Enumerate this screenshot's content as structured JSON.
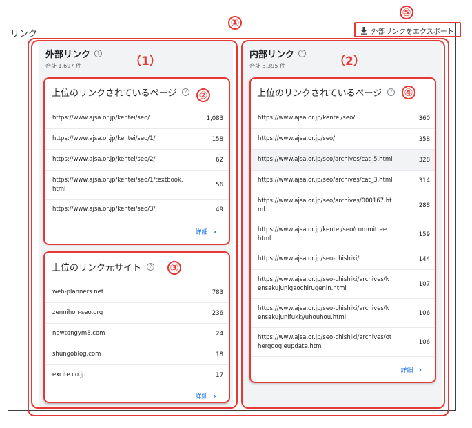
{
  "page": {
    "title": "リンク"
  },
  "export": {
    "label": "外部リンクをエクスポート",
    "icon": "download-icon"
  },
  "external": {
    "title": "外部リンク",
    "total": "合計 1,697 件",
    "top_pages": {
      "title": "上位のリンクされているページ",
      "rows": [
        {
          "url": "https://www.ajsa.or.jp/kentei/seo/",
          "count": "1,083"
        },
        {
          "url": "https://www.ajsa.or.jp/kentei/seo/1/",
          "count": "158"
        },
        {
          "url": "https://www.ajsa.or.jp/kentei/seo/2/",
          "count": "62"
        },
        {
          "url": "https://www.ajsa.or.jp/kentei/seo/1/textbook.html",
          "count": "56"
        },
        {
          "url": "https://www.ajsa.or.jp/kentei/seo/3/",
          "count": "49"
        }
      ],
      "more_label": "詳細"
    },
    "top_sites": {
      "title": "上位のリンク元サイト",
      "rows": [
        {
          "site": "web-planners.net",
          "count": "783"
        },
        {
          "site": "zennihon-seo.org",
          "count": "236"
        },
        {
          "site": "newtongym8.com",
          "count": "24"
        },
        {
          "site": "shungoblog.com",
          "count": "18"
        },
        {
          "site": "excite.co.jp",
          "count": "17"
        }
      ],
      "more_label": "詳細"
    }
  },
  "internal": {
    "title": "内部リンク",
    "total": "合計 3,395 件",
    "top_pages": {
      "title": "上位のリンクされているページ",
      "rows": [
        {
          "url": "https://www.ajsa.or.jp/kentei/seo/",
          "count": "360"
        },
        {
          "url": "https://www.ajsa.or.jp/seo/",
          "count": "358"
        },
        {
          "url": "https://www.ajsa.or.jp/seo/archives/cat_5.html",
          "count": "328"
        },
        {
          "url": "https://www.ajsa.or.jp/seo/archives/cat_3.html",
          "count": "314"
        },
        {
          "url": "https://www.ajsa.or.jp/seo/archives/000167.html",
          "count": "288"
        },
        {
          "url": "https://www.ajsa.or.jp/kentei/seo/committee.html",
          "count": "159"
        },
        {
          "url": "https://www.ajsa.or.jp/seo-chishiki/",
          "count": "144"
        },
        {
          "url": "https://www.ajsa.or.jp/seo-chishiki/archives/kensakujunigaochirugenin.html",
          "count": "107"
        },
        {
          "url": "https://www.ajsa.or.jp/seo-chishiki/archives/kensakujunifukkyuhouhou.html",
          "count": "106"
        },
        {
          "url": "https://www.ajsa.or.jp/seo-chishiki/archives/othergoogleupdate.html",
          "count": "106"
        }
      ],
      "more_label": "詳細"
    }
  },
  "annotations": {
    "n1": "①",
    "n2": "②",
    "n3": "③",
    "n4": "④",
    "n5": "⑤",
    "p1": "（1）",
    "p2": "（2）"
  },
  "colors": {
    "annotation": "#e53935",
    "link": "#1a73e8",
    "background": "#f1f3f4"
  }
}
